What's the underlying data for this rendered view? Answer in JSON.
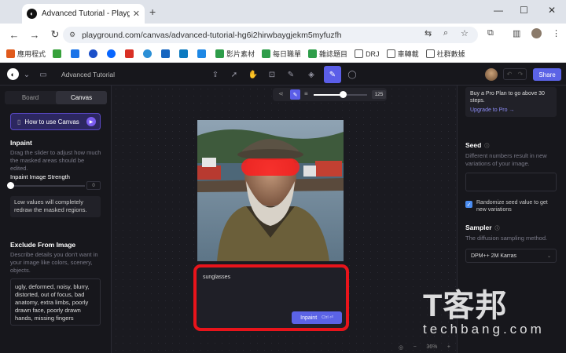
{
  "browser": {
    "tab_title": "Advanced Tutorial - Playgrou",
    "tab_close": "✕",
    "new_tab": "+",
    "window_controls": [
      "—",
      "☐",
      "✕"
    ],
    "url": "playground.com/canvas/advanced-tutorial-hg6i2hirwbaygjekm5myfuzfh",
    "bookmarks": [
      "應用程式",
      "",
      "",
      "",
      "",
      "",
      "",
      "",
      "",
      "",
      "影片素材",
      "每日職單",
      "雜誌題目",
      "DRJ",
      "車轉載",
      "社群數據"
    ]
  },
  "app": {
    "title": "Advanced Tutorial",
    "share": "Share",
    "tabs": {
      "board": "Board",
      "canvas": "Canvas"
    },
    "howto": "How to use Canvas",
    "inpaint_heading": "Inpaint",
    "inpaint_desc": "Drag the slider to adjust how much the masked areas should be edited.",
    "strength_label": "Inpaint Image Strength",
    "strength_value": "0",
    "strength_note": "Low values will completely redraw the masked regions.",
    "exclude_heading": "Exclude From Image",
    "exclude_desc": "Describe details you don't want in your image like colors, scenery, objects.",
    "exclude_text": "ugly, deformed, noisy, blurry, distorted, out of focus, bad anatomy, extra limbs, poorly drawn face, poorly drawn hands, missing fingers",
    "brush_size": "125",
    "prompt_text": "sunglasses",
    "inpaint_button": "Inpaint",
    "shortcut": "Ctrl ⏎",
    "zoom": "36%",
    "pro_text": "Buy a Pro Plan to go above 30 steps.",
    "pro_link": "Upgrade to Pro →",
    "seed_heading": "Seed",
    "seed_desc": "Different numbers result in new variations of your image.",
    "randomize": "Randomize seed value to get new variations",
    "sampler_heading": "Sampler",
    "sampler_desc": "The diffusion sampling method.",
    "sampler_value": "DPM++ 2M Karras"
  },
  "watermark": {
    "brand": "T客邦",
    "site": "techbang.com"
  },
  "colors": {
    "accent": "#5b63e6",
    "highlight": "#e8141b",
    "mask": "#ff1e1e"
  }
}
